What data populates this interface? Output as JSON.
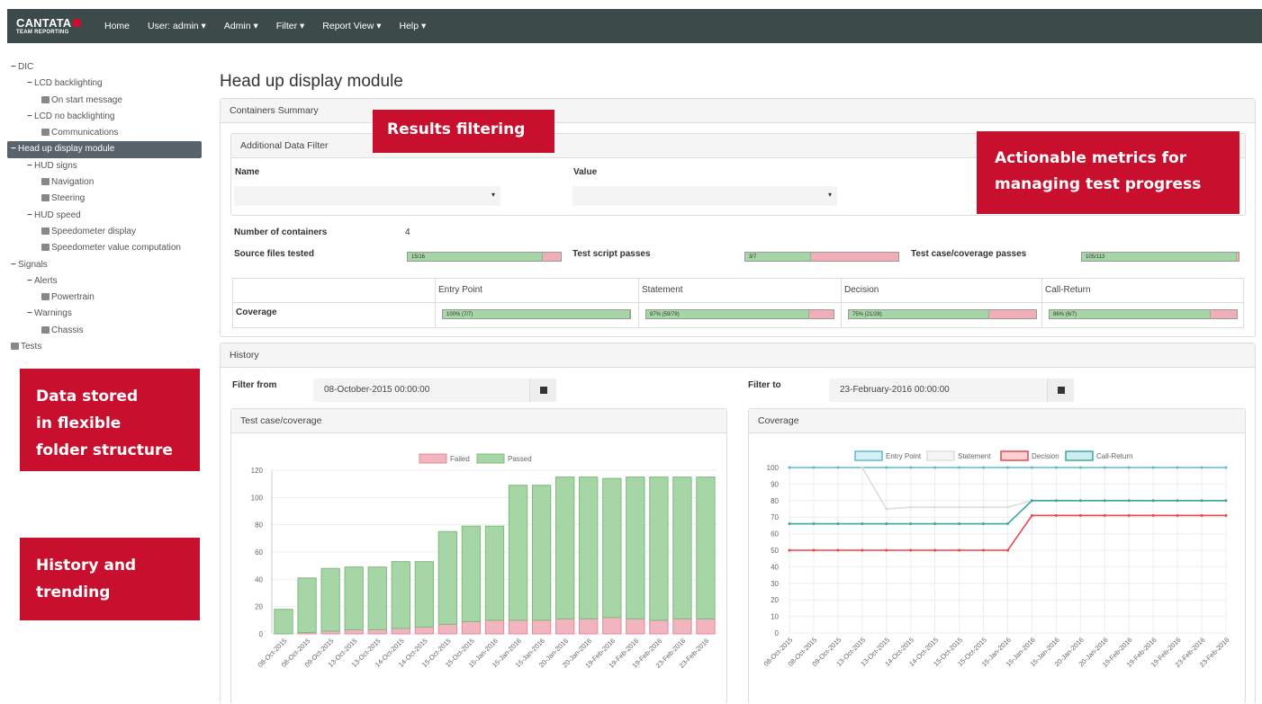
{
  "navbar": {
    "brand": "CANTATA",
    "brand_sub": "TEAM REPORTING",
    "items": [
      "Home",
      "User: admin ▾",
      "Admin ▾",
      "Filter ▾",
      "Report View ▾",
      "Help ▾"
    ]
  },
  "tree": [
    {
      "label": "DIC",
      "toggle": "−",
      "level": 0
    },
    {
      "label": "LCD backlighting",
      "toggle": "−",
      "level": 1
    },
    {
      "label": "On start message",
      "file": true,
      "level": 2
    },
    {
      "label": "LCD no backlighting",
      "toggle": "−",
      "level": 1
    },
    {
      "label": "Communications",
      "file": true,
      "level": 2
    },
    {
      "label": "Head up display module",
      "toggle": "−",
      "level": 0,
      "selected": true
    },
    {
      "label": "HUD signs",
      "toggle": "−",
      "level": 1
    },
    {
      "label": "Navigation",
      "file": true,
      "level": 2
    },
    {
      "label": "Steering",
      "file": true,
      "level": 2
    },
    {
      "label": "HUD speed",
      "toggle": "−",
      "level": 1
    },
    {
      "label": "Speedometer display",
      "file": true,
      "level": 2
    },
    {
      "label": "Speedometer value computation",
      "file": true,
      "level": 2
    },
    {
      "label": "Signals",
      "toggle": "−",
      "level": 0
    },
    {
      "label": "Alerts",
      "toggle": "−",
      "level": 1
    },
    {
      "label": "Powertrain",
      "file": true,
      "level": 2
    },
    {
      "label": "Warnings",
      "toggle": "−",
      "level": 1
    },
    {
      "label": "Chassis",
      "file": true,
      "level": 2
    },
    {
      "label": "Tests",
      "file": true,
      "level": 0
    }
  ],
  "callouts": {
    "results_filtering": "Results filtering",
    "actionable_1": "Actionable metrics for",
    "actionable_2": "managing  test progress",
    "data_stored_1": "Data stored",
    "data_stored_2": "in flexible",
    "data_stored_3": "folder structure",
    "history_1": "History and",
    "history_2": "trending"
  },
  "page_title": "Head up display module",
  "containers": {
    "title": "Containers Summary",
    "filter_title": "Additional Data Filter",
    "name_label": "Name",
    "value_label": "Value",
    "count_label": "Number of containers",
    "count_value": "4",
    "source_label": "Source files tested",
    "source_text": "15/16",
    "source_fraction": 0.88,
    "script_label": "Test script passes",
    "script_text": "3/7",
    "script_fraction": 0.43,
    "case_label": "Test case/coverage passes",
    "case_text": "105/113",
    "case_fraction": 0.99
  },
  "coverage": {
    "row_label": "Coverage",
    "columns": [
      {
        "name": "Entry Point",
        "text": "100% (7/7)",
        "fraction": 1.0
      },
      {
        "name": "Statement",
        "text": "87% (59/79)",
        "fraction": 0.87
      },
      {
        "name": "Decision",
        "text": "75% (21/28)",
        "fraction": 0.75
      },
      {
        "name": "Call-Return",
        "text": "86% (6/7)",
        "fraction": 0.86
      }
    ]
  },
  "history": {
    "title": "History",
    "from_label": "Filter from",
    "from_value": "08-October-2015 00:00:00",
    "to_label": "Filter to",
    "to_value": "23-February-2016 00:00:00"
  },
  "colors": {
    "failed": "#f2b5bf",
    "passed": "#a6d6a6",
    "entry": "#5bbccf",
    "statement": "#dddddd",
    "decision": "#e8474d",
    "callreturn": "#3aa6a3",
    "callout": "#c8102e"
  },
  "chart_data": [
    {
      "type": "bar",
      "title": "Test case/coverage",
      "stacked": true,
      "categories": [
        "08-Oct-2015",
        "08-Oct-2015",
        "09-Oct-2015",
        "13-Oct-2015",
        "13-Oct-2015",
        "14-Oct-2015",
        "14-Oct-2015",
        "15-Oct-2015",
        "15-Oct-2015",
        "15-Jan-2016",
        "15-Jan-2016",
        "15-Jan-2016",
        "20-Jan-2016",
        "20-Jan-2016",
        "19-Feb-2016",
        "19-Feb-2016",
        "19-Feb-2016",
        "23-Feb-2016",
        "23-Feb-2016"
      ],
      "series": [
        {
          "name": "Failed",
          "values": [
            0,
            1,
            2,
            3,
            3,
            4,
            5,
            7,
            9,
            10,
            10,
            10,
            11,
            11,
            12,
            11,
            10,
            11,
            11
          ]
        },
        {
          "name": "Passed",
          "values": [
            18,
            40,
            46,
            46,
            46,
            49,
            48,
            68,
            70,
            69,
            99,
            99,
            104,
            104,
            102,
            104,
            105,
            104,
            104
          ]
        }
      ],
      "ylim": [
        0,
        120
      ],
      "yticks": [
        0,
        20,
        40,
        60,
        80,
        100,
        120
      ],
      "legend": "top"
    },
    {
      "type": "line",
      "title": "Coverage",
      "categories": [
        "08-Oct-2015",
        "08-Oct-2015",
        "09-Oct-2015",
        "13-Oct-2015",
        "13-Oct-2015",
        "14-Oct-2015",
        "14-Oct-2015",
        "15-Oct-2015",
        "15-Oct-2015",
        "15-Jan-2016",
        "15-Jan-2016",
        "15-Jan-2016",
        "20-Jan-2016",
        "20-Jan-2016",
        "19-Feb-2016",
        "19-Feb-2016",
        "19-Feb-2016",
        "23-Feb-2016",
        "23-Feb-2016"
      ],
      "series": [
        {
          "name": "Entry Point",
          "values": [
            100,
            100,
            100,
            100,
            100,
            100,
            100,
            100,
            100,
            100,
            100,
            100,
            100,
            100,
            100,
            100,
            100,
            100,
            100
          ]
        },
        {
          "name": "Statement",
          "values": [
            null,
            null,
            null,
            100,
            75,
            76,
            76,
            76,
            76,
            76,
            80,
            80,
            80,
            80,
            80,
            80,
            80,
            80,
            80
          ]
        },
        {
          "name": "Decision",
          "values": [
            50,
            50,
            50,
            50,
            50,
            50,
            50,
            50,
            50,
            50,
            71,
            71,
            71,
            71,
            71,
            71,
            71,
            71,
            71
          ]
        },
        {
          "name": "Call-Return",
          "values": [
            66,
            66,
            66,
            66,
            66,
            66,
            66,
            66,
            66,
            66,
            80,
            80,
            80,
            80,
            80,
            80,
            80,
            80,
            80
          ]
        }
      ],
      "ylim": [
        0,
        100
      ],
      "yticks": [
        0,
        10,
        20,
        30,
        40,
        50,
        60,
        70,
        80,
        90,
        100
      ],
      "legend": "top"
    }
  ]
}
